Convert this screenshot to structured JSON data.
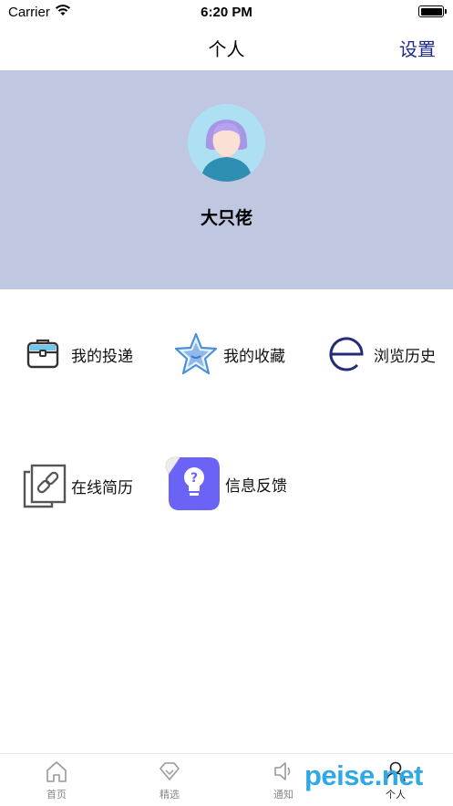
{
  "status_bar": {
    "carrier": "Carrier",
    "time": "6:20 PM"
  },
  "nav": {
    "title": "个人",
    "settings_label": "设置"
  },
  "profile": {
    "username": "大只佬",
    "header_color": "#c0c7e1"
  },
  "menu": {
    "items": [
      {
        "label": "我的投递",
        "icon": "briefcase-icon"
      },
      {
        "label": "我的收藏",
        "icon": "star-icon"
      },
      {
        "label": "浏览历史",
        "icon": "history-e-icon"
      },
      {
        "label": "在线简历",
        "icon": "resume-link-icon"
      },
      {
        "label": "信息反馈",
        "icon": "feedback-bulb-icon"
      }
    ]
  },
  "tab_bar": {
    "tabs": [
      {
        "label": "首页",
        "icon": "home-icon",
        "active": false
      },
      {
        "label": "精选",
        "icon": "diamond-icon",
        "active": false
      },
      {
        "label": "通知",
        "icon": "speaker-icon",
        "active": false
      },
      {
        "label": "个人",
        "icon": "person-icon",
        "active": true
      }
    ]
  },
  "watermark": "peise.net",
  "colors": {
    "accent": "#1f2a8a",
    "feedback": "#6b63f5",
    "watermark": "#2ea8e6"
  }
}
